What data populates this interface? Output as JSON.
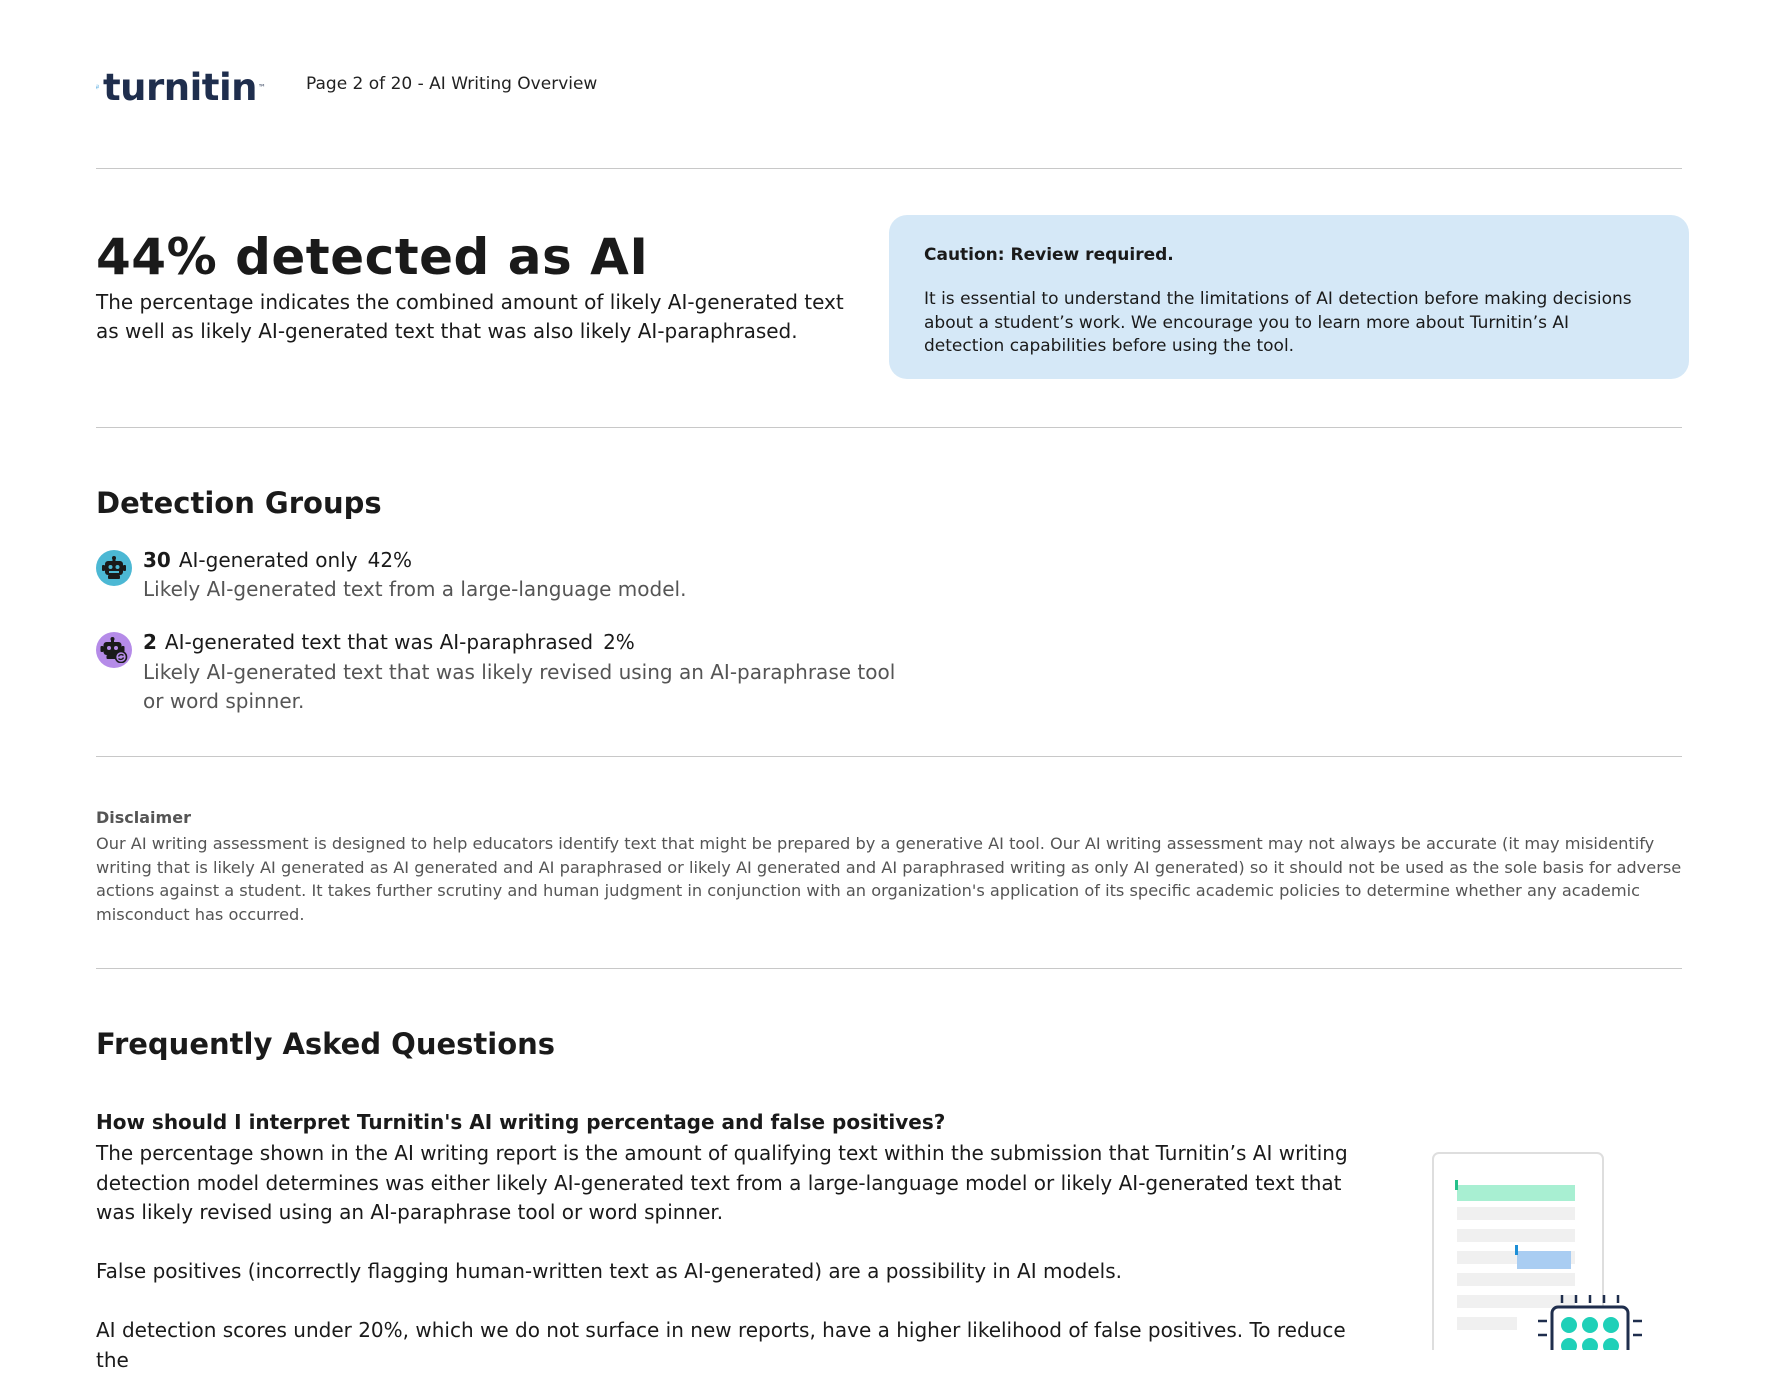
{
  "header": {
    "logo_text": "turnitin",
    "page_label": "Page 2 of 20 - AI Writing Overview"
  },
  "summary": {
    "heading": "44% detected as AI",
    "description": "The percentage indicates the combined amount of likely AI-generated text as well as likely AI-generated text that was also likely AI-paraphrased."
  },
  "caution": {
    "title": "Caution: Review required.",
    "body": "It is essential to understand the limitations of AI detection before making decisions about a student’s work. We encourage you to learn more about Turnitin’s AI detection capabilities before using the tool."
  },
  "detection_groups": {
    "title": "Detection Groups",
    "groups": [
      {
        "count": "30",
        "label": "AI-generated only",
        "percent": "42%",
        "description": "Likely AI-generated text from a large-language model.",
        "icon": "robot-icon",
        "color": "#4cb8d4"
      },
      {
        "count": "2",
        "label": "AI-generated text that was AI-paraphrased",
        "percent": "2%",
        "description": "Likely AI-generated text that was likely revised using an AI-paraphrase tool or word spinner.",
        "icon": "robot-paraphrase-icon",
        "color": "#b58be8"
      }
    ]
  },
  "disclaimer": {
    "title": "Disclaimer",
    "body": "Our AI writing assessment is designed to help educators identify text that might be prepared by a generative AI tool. Our AI writing assessment may not always be accurate (it may misidentify writing that is likely AI generated as AI generated and AI paraphrased or likely AI generated and AI paraphrased writing as only AI generated) so it should not be used as the sole basis for adverse actions against a student. It takes further scrutiny and human judgment in conjunction with an organization's application of its specific academic policies to determine whether any academic misconduct has occurred."
  },
  "faq": {
    "title": "Frequently Asked Questions",
    "question": "How should I interpret Turnitin's AI writing percentage and false positives?",
    "paragraphs": [
      "The percentage shown in the AI writing report is the amount of qualifying text within the submission that Turnitin’s AI writing detection model determines was either likely AI-generated text from a large-language model or likely AI-generated text that was likely revised using an AI-paraphrase tool or word spinner.",
      "False positives (incorrectly flagging human-written text as AI-generated) are a possibility in AI models.",
      "AI detection scores under 20%, which we do not surface in new reports, have a higher likelihood of false positives. To reduce the"
    ]
  },
  "colors": {
    "brand": "#1f2e4d",
    "logo_arrow": "#1d8fd6",
    "caution_bg": "#d5e8f7",
    "ai_generated": "#4cb8d4",
    "ai_paraphrased": "#b58be8"
  }
}
